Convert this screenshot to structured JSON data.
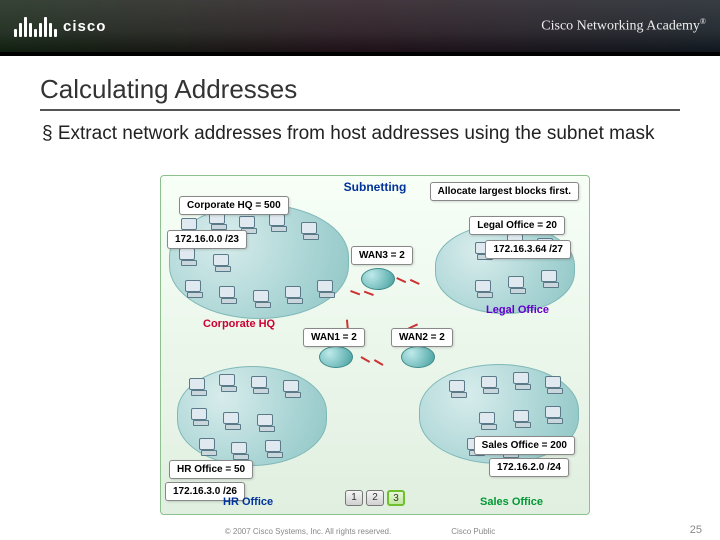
{
  "header": {
    "brand": "cisco",
    "academy": "Cisco Networking Academy"
  },
  "title": "Calculating Addresses",
  "bullet": "Extract network addresses from host addresses using the subnet mask",
  "diagram": {
    "title": "Subnetting",
    "alloc_note": "Allocate largest blocks first.",
    "sites": {
      "hq": {
        "name_box": "Corporate HQ = 500",
        "cidr": "172.16.0.0 /23",
        "caption": "Corporate HQ"
      },
      "legal": {
        "name_box": "Legal Office = 20",
        "cidr": "172.16.3.64 /27",
        "caption": "Legal Office"
      },
      "hr": {
        "name_box": "HR Office = 50",
        "cidr": "172.16.3.0 /26",
        "caption": "HR Office"
      },
      "sales": {
        "name_box": "Sales Office = 200",
        "cidr": "172.16.2.0 /24",
        "caption": "Sales Office"
      }
    },
    "wans": {
      "wan1": "WAN1 = 2",
      "wan2": "WAN2 = 2",
      "wan3": "WAN3 = 2"
    },
    "pager": {
      "p1": "1",
      "p2": "2",
      "p3": "3"
    }
  },
  "footer": {
    "copyright": "© 2007 Cisco Systems, Inc. All rights reserved.",
    "classification": "Cisco Public"
  },
  "slide_number": "25"
}
